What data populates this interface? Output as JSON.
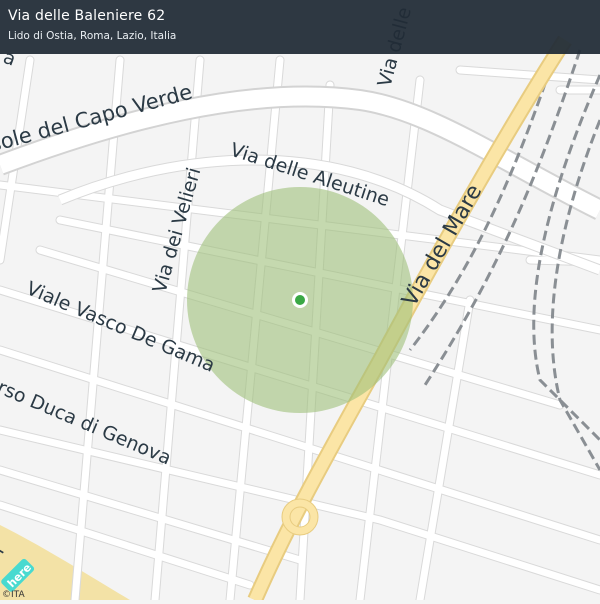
{
  "header": {
    "address": "Via delle Baleniere 62",
    "locality": "Lido di Ostia, Roma, Lazio, Italia"
  },
  "map": {
    "colors": {
      "background": "#f4f4f4",
      "road": "#ffffff",
      "road_edge": "#d6d6d6",
      "main_road": "#fbe5a6",
      "main_road_edge": "#e8cc80",
      "railway": "#8a8f94",
      "sand": "#f3e2a6",
      "circle_fill": "#9fc07a",
      "marker": "#3aa845"
    },
    "labels": {
      "capo_verde": "sole  del  Capo  Verde",
      "aleutine": "Via   delle  Aleutine",
      "velieri": "Via  dei  Velieri",
      "vasco": "Viale  Vasco  De  Gama",
      "genova": "rso  Duca  di  Genova",
      "mare": "Via  del  Mare",
      "delle_top": "Via  delle",
      "fragment_a": "a",
      "fragment_i": "i"
    },
    "here_logo": "here",
    "attribution": "©ITA"
  }
}
